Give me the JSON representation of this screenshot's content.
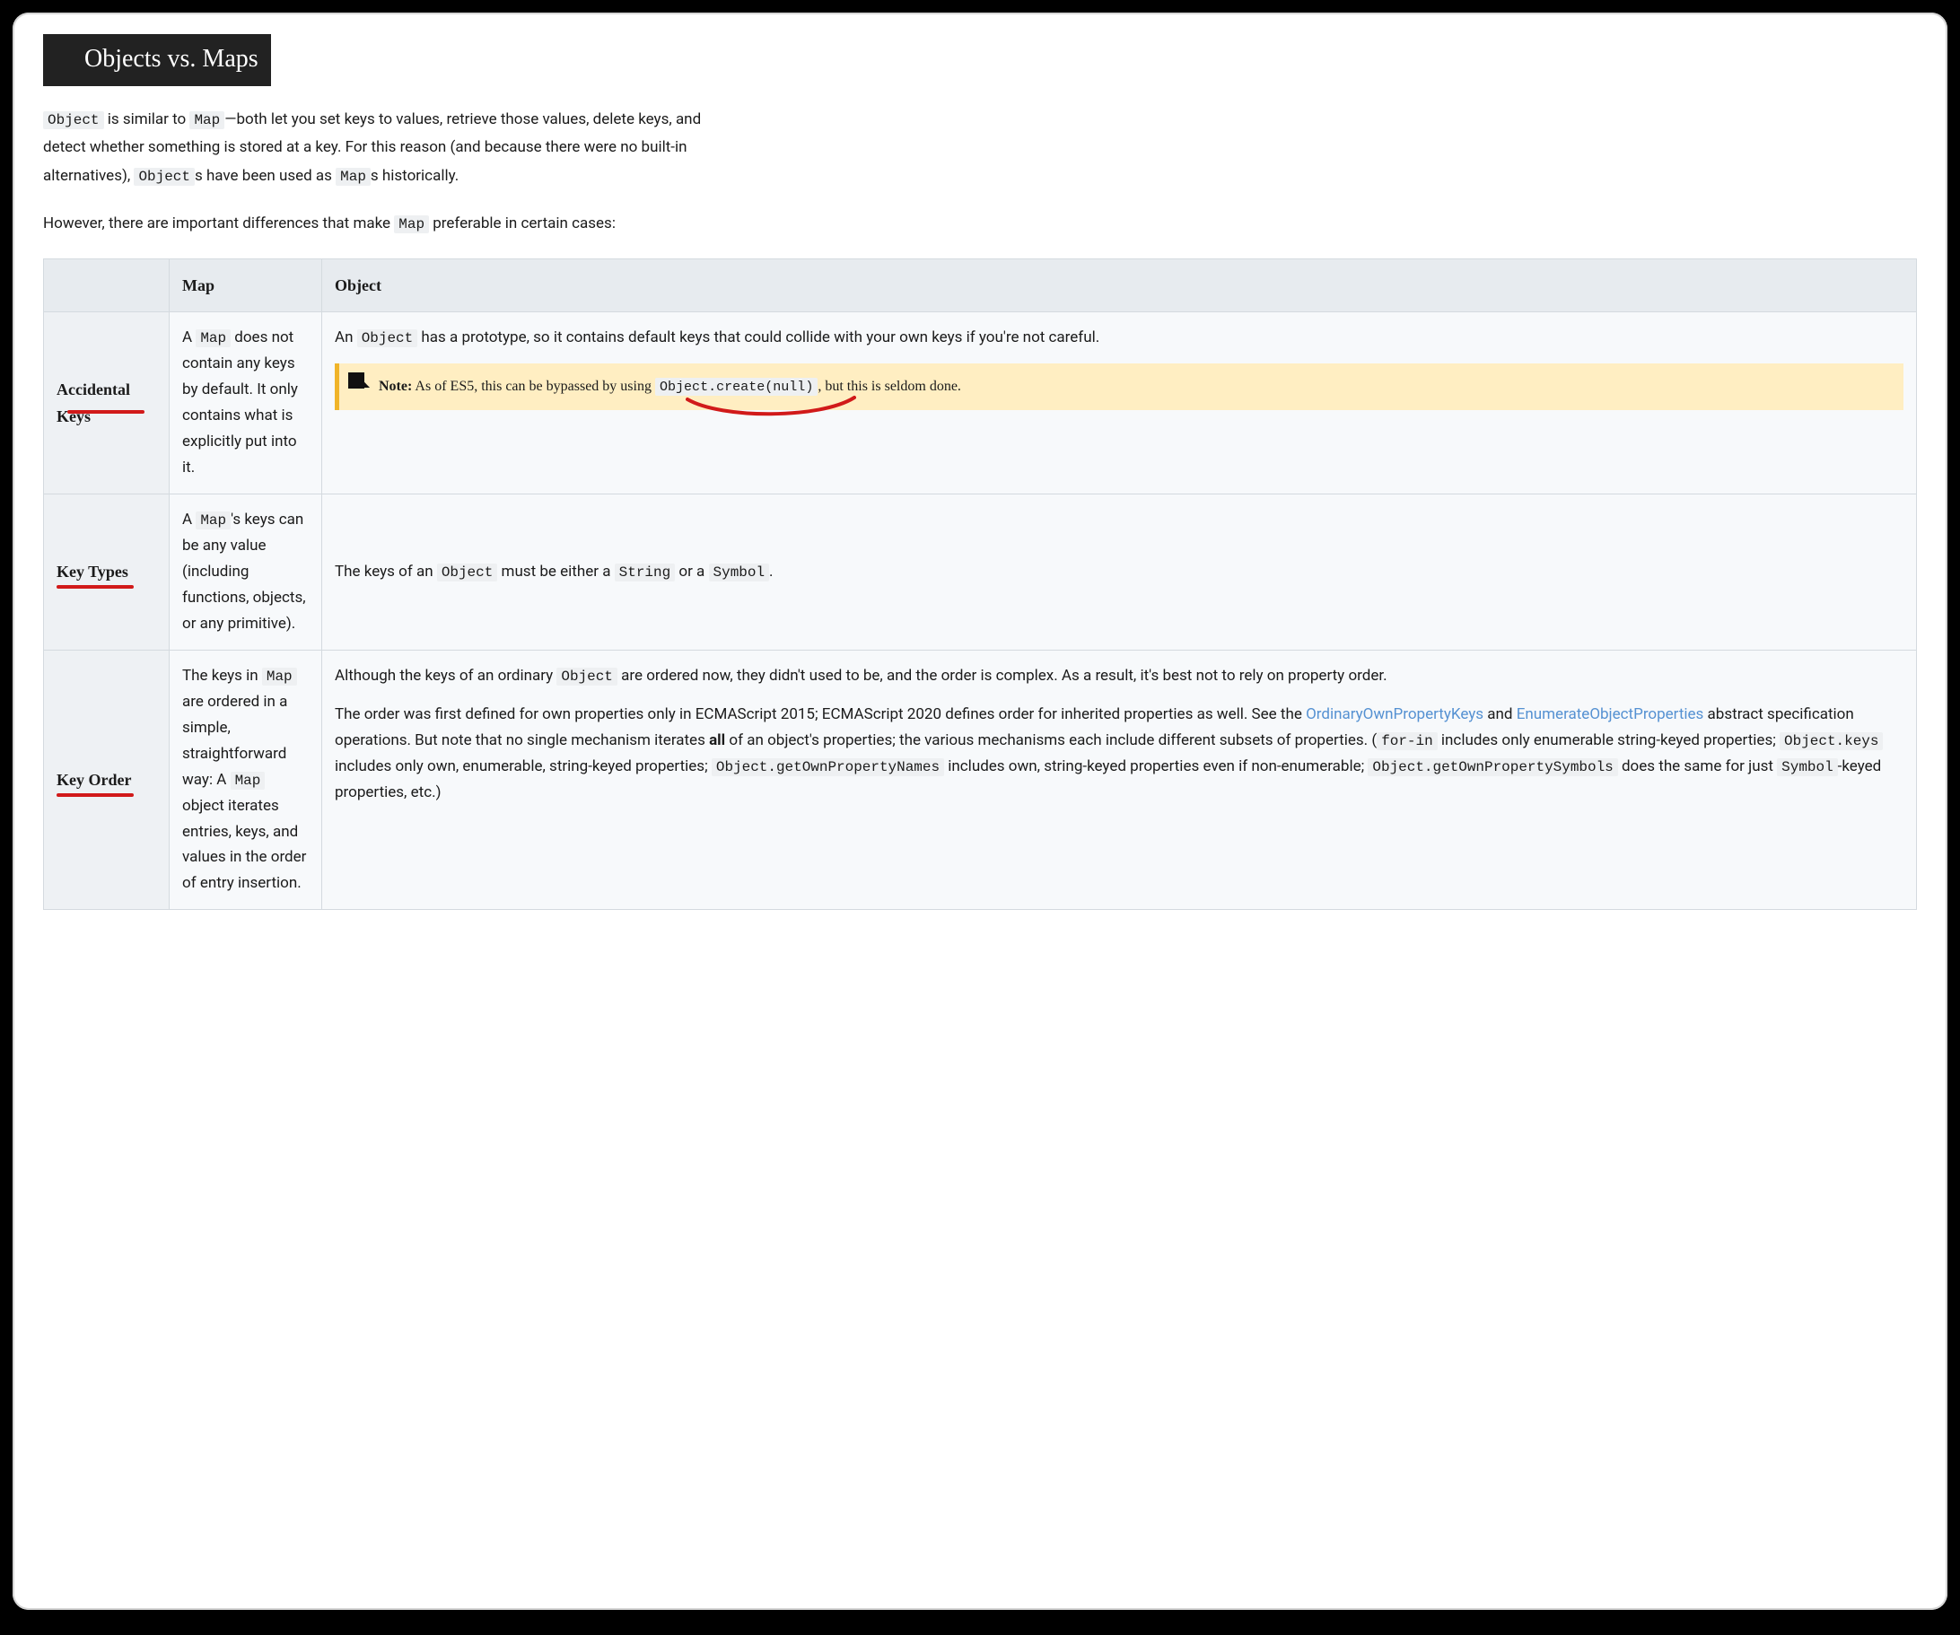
{
  "heading": "Objects vs. Maps",
  "intro1_parts": {
    "a": " is similar to ",
    "b": "—both let you set keys to values, retrieve those values, delete keys, and detect whether something is stored at a key. For this reason (and because there were no built-in alternatives), ",
    "c": "s have been used as ",
    "d": "s historically."
  },
  "codes": {
    "object": "Object",
    "map": "Map",
    "string": "String",
    "symbol": "Symbol",
    "objCreateNull": "Object.create(null)",
    "forin": "for-in",
    "objKeys": "Object.keys",
    "ogopn": "Object.getOwnPropertyNames",
    "ogops": "Object.getOwnPropertySymbols"
  },
  "intro2_parts": {
    "a": "However, there are important differences that make ",
    "b": " preferable in certain cases:"
  },
  "table": {
    "head": {
      "blank": "",
      "map": "Map",
      "object": "Object"
    },
    "rows": [
      {
        "label": "Accidental Keys",
        "map_text": {
          "a": "A ",
          "b": " does not contain any keys by default. It only contains what is explicitly put into it."
        },
        "obj_intro": {
          "a": "An ",
          "b": " has a prototype, so it contains default keys that could collide with your own keys if you're not careful."
        },
        "note": {
          "label": "Note:",
          "a": " As of ES5, this can be bypassed by using ",
          "b": ", but this is seldom done."
        }
      },
      {
        "label": "Key Types",
        "map_text": {
          "a": "A ",
          "b": "'s keys can be any value (including functions, objects, or any primitive)."
        },
        "obj_text": {
          "a": "The keys of an ",
          "b": " must be either a ",
          "c": " or a ",
          "d": "."
        }
      },
      {
        "label": "Key Order",
        "map_text": {
          "a": "The keys in ",
          "b": " are ordered in a simple, straightforward way: A ",
          "c": " object iterates entries, keys, and values in the order of entry insertion."
        },
        "obj_p1": {
          "a": "Although the keys of an ordinary ",
          "b": " are ordered now, they didn't used to be, and the order is complex. As a result, it's best not to rely on property order."
        },
        "obj_p2": {
          "a": "The order was first defined for own properties only in ECMAScript 2015; ECMAScript 2020 defines order for inherited properties as well. See the ",
          "link1": "OrdinaryOwnPropertyKeys",
          "mid": " and ",
          "link2": "EnumerateObjectProperties",
          "b": " abstract specification operations. But note that no single mechanism iterates ",
          "all": "all",
          "c": " of an object's properties; the various mechanisms each include different subsets of properties. (",
          "d": " includes only enumerable string-keyed properties; ",
          "e": " includes only own, enumerable, string-keyed properties; ",
          "f": " includes own, string-keyed properties even if non-enumerable; ",
          "g": " does the same for just ",
          "h": "-keyed properties, etc.)"
        }
      }
    ]
  }
}
